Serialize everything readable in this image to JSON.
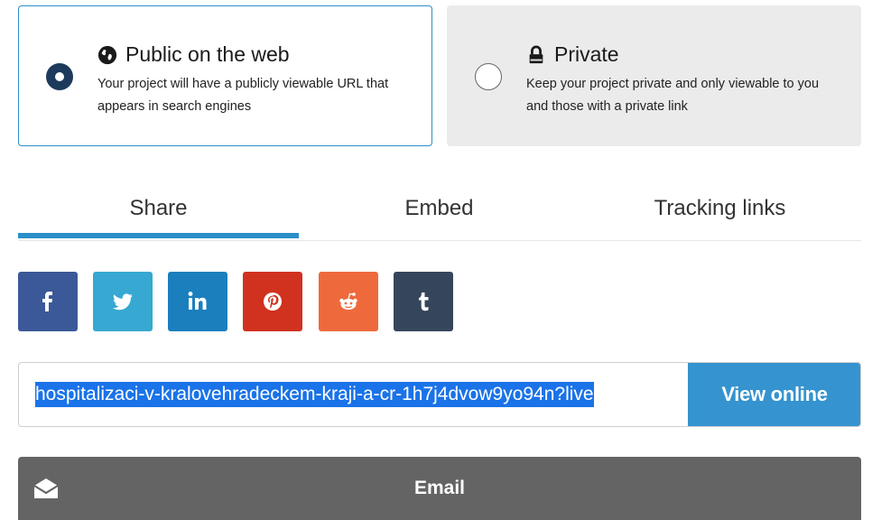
{
  "visibility": {
    "public": {
      "title": "Public on the web",
      "description": "Your project will have a publicly viewable URL that appears in search engines",
      "selected": true,
      "icon": "globe-icon"
    },
    "private": {
      "title": "Private",
      "description": "Keep your project private and only viewable to you and those with a private link",
      "selected": false,
      "icon": "lock-icon"
    }
  },
  "tabs": [
    {
      "label": "Share",
      "active": true
    },
    {
      "label": "Embed",
      "active": false
    },
    {
      "label": "Tracking links",
      "active": false
    }
  ],
  "social": [
    {
      "name": "facebook",
      "color": "#3b5998",
      "icon": "facebook-icon"
    },
    {
      "name": "twitter",
      "color": "#37a8d1",
      "icon": "twitter-icon"
    },
    {
      "name": "linkedin",
      "color": "#1b7fbd",
      "icon": "linkedin-icon"
    },
    {
      "name": "pinterest",
      "color": "#d0321f",
      "icon": "pinterest-icon"
    },
    {
      "name": "reddit",
      "color": "#ee6a3d",
      "icon": "reddit-icon"
    },
    {
      "name": "tumblr",
      "color": "#35465c",
      "icon": "tumblr-icon"
    }
  ],
  "share_url": {
    "value": "hospitalizaci-v-kralovehradeckem-kraji-a-cr-1h7j4dvow9yo94n?live",
    "button_label": "View online"
  },
  "email": {
    "label": "Email"
  },
  "colors": {
    "accent": "#2b8fc9",
    "selected_radio": "#1d3a5c",
    "email_bg": "#646464"
  }
}
